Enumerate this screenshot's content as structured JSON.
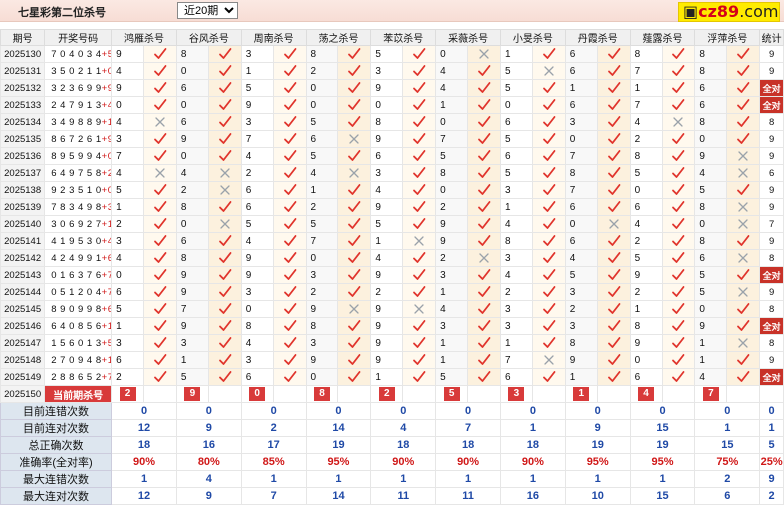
{
  "header": {
    "title": "七星彩第二位杀号",
    "range_selected": "近20期",
    "brand": {
      "icon": "square-icon",
      "main": "cz89",
      "domain": ".com"
    }
  },
  "columns": [
    "期号",
    "开奖号码",
    "鸿雁杀号",
    "谷风杀号",
    "周南杀号",
    "荡之杀号",
    "苯苡杀号",
    "采薇杀号",
    "小旻杀号",
    "丹霞杀号",
    "薤露杀号",
    "浮萍杀号",
    "统计"
  ],
  "rows": [
    {
      "p": "2025130",
      "d": "704034",
      "s": "+5",
      "k": [
        [
          "9",
          1
        ],
        [
          "8",
          1
        ],
        [
          "3",
          1
        ],
        [
          "8",
          1
        ],
        [
          "5",
          1
        ],
        [
          "0",
          0
        ],
        [
          "1",
          1
        ],
        [
          "6",
          1
        ],
        [
          "8",
          1
        ],
        [
          "8",
          1
        ]
      ],
      "st": "9"
    },
    {
      "p": "2025131",
      "d": "350211",
      "s": "+0",
      "k": [
        [
          "4",
          1
        ],
        [
          "0",
          1
        ],
        [
          "1",
          1
        ],
        [
          "2",
          1
        ],
        [
          "3",
          1
        ],
        [
          "4",
          1
        ],
        [
          "5",
          0
        ],
        [
          "6",
          1
        ],
        [
          "7",
          1
        ],
        [
          "8",
          1
        ]
      ],
      "st": "9"
    },
    {
      "p": "2025132",
      "d": "323699",
      "s": "+9",
      "k": [
        [
          "9",
          1
        ],
        [
          "6",
          1
        ],
        [
          "5",
          1
        ],
        [
          "0",
          1
        ],
        [
          "9",
          1
        ],
        [
          "4",
          1
        ],
        [
          "5",
          1
        ],
        [
          "1",
          1
        ],
        [
          "1",
          1
        ],
        [
          "6",
          1
        ]
      ],
      "st": "全对"
    },
    {
      "p": "2025133",
      "d": "247913",
      "s": "+4",
      "k": [
        [
          "0",
          1
        ],
        [
          "0",
          1
        ],
        [
          "9",
          1
        ],
        [
          "0",
          1
        ],
        [
          "0",
          1
        ],
        [
          "1",
          1
        ],
        [
          "0",
          1
        ],
        [
          "6",
          1
        ],
        [
          "7",
          1
        ],
        [
          "6",
          1
        ]
      ],
      "st": "全对"
    },
    {
      "p": "2025134",
      "d": "349889",
      "s": "+13",
      "k": [
        [
          "4",
          0
        ],
        [
          "6",
          1
        ],
        [
          "3",
          1
        ],
        [
          "5",
          1
        ],
        [
          "8",
          1
        ],
        [
          "0",
          1
        ],
        [
          "6",
          1
        ],
        [
          "3",
          1
        ],
        [
          "4",
          0
        ],
        [
          "8",
          1
        ]
      ],
      "st": "8"
    },
    {
      "p": "2025135",
      "d": "867261",
      "s": "+9",
      "k": [
        [
          "3",
          1
        ],
        [
          "9",
          1
        ],
        [
          "7",
          1
        ],
        [
          "6",
          0
        ],
        [
          "9",
          1
        ],
        [
          "7",
          1
        ],
        [
          "5",
          1
        ],
        [
          "0",
          1
        ],
        [
          "2",
          1
        ],
        [
          "0",
          1
        ]
      ],
      "st": "9"
    },
    {
      "p": "2025136",
      "d": "895994",
      "s": "+0",
      "k": [
        [
          "7",
          1
        ],
        [
          "0",
          1
        ],
        [
          "4",
          1
        ],
        [
          "5",
          1
        ],
        [
          "6",
          1
        ],
        [
          "5",
          1
        ],
        [
          "6",
          1
        ],
        [
          "7",
          1
        ],
        [
          "8",
          1
        ],
        [
          "9",
          0
        ]
      ],
      "st": "9"
    },
    {
      "p": "2025137",
      "d": "649758",
      "s": "+2",
      "k": [
        [
          "4",
          0
        ],
        [
          "4",
          0
        ],
        [
          "2",
          1
        ],
        [
          "4",
          0
        ],
        [
          "3",
          1
        ],
        [
          "8",
          1
        ],
        [
          "5",
          1
        ],
        [
          "8",
          1
        ],
        [
          "5",
          1
        ],
        [
          "4",
          0
        ]
      ],
      "st": "6"
    },
    {
      "p": "2025138",
      "d": "923510",
      "s": "+0",
      "k": [
        [
          "5",
          1
        ],
        [
          "2",
          0
        ],
        [
          "6",
          1
        ],
        [
          "1",
          1
        ],
        [
          "4",
          1
        ],
        [
          "0",
          1
        ],
        [
          "3",
          1
        ],
        [
          "7",
          1
        ],
        [
          "0",
          1
        ],
        [
          "5",
          1
        ]
      ],
      "st": "9"
    },
    {
      "p": "2025139",
      "d": "783498",
      "s": "+3",
      "k": [
        [
          "1",
          1
        ],
        [
          "8",
          1
        ],
        [
          "6",
          1
        ],
        [
          "2",
          1
        ],
        [
          "9",
          1
        ],
        [
          "2",
          1
        ],
        [
          "1",
          1
        ],
        [
          "6",
          1
        ],
        [
          "6",
          1
        ],
        [
          "8",
          0
        ]
      ],
      "st": "9"
    },
    {
      "p": "2025140",
      "d": "306927",
      "s": "+11",
      "k": [
        [
          "2",
          1
        ],
        [
          "0",
          0
        ],
        [
          "5",
          1
        ],
        [
          "5",
          1
        ],
        [
          "5",
          1
        ],
        [
          "9",
          1
        ],
        [
          "4",
          1
        ],
        [
          "0",
          0
        ],
        [
          "4",
          1
        ],
        [
          "0",
          0
        ]
      ],
      "st": "7"
    },
    {
      "p": "2025141",
      "d": "419530",
      "s": "+4",
      "k": [
        [
          "3",
          1
        ],
        [
          "6",
          1
        ],
        [
          "4",
          1
        ],
        [
          "7",
          1
        ],
        [
          "1",
          0
        ],
        [
          "9",
          1
        ],
        [
          "8",
          1
        ],
        [
          "6",
          1
        ],
        [
          "2",
          1
        ],
        [
          "8",
          1
        ]
      ],
      "st": "9"
    },
    {
      "p": "2025142",
      "d": "424991",
      "s": "+6",
      "k": [
        [
          "4",
          1
        ],
        [
          "8",
          1
        ],
        [
          "9",
          1
        ],
        [
          "0",
          1
        ],
        [
          "4",
          1
        ],
        [
          "2",
          0
        ],
        [
          "3",
          1
        ],
        [
          "4",
          1
        ],
        [
          "5",
          1
        ],
        [
          "6",
          0
        ]
      ],
      "st": "8"
    },
    {
      "p": "2025143",
      "d": "016376",
      "s": "+7",
      "k": [
        [
          "0",
          1
        ],
        [
          "9",
          1
        ],
        [
          "9",
          1
        ],
        [
          "3",
          1
        ],
        [
          "9",
          1
        ],
        [
          "3",
          1
        ],
        [
          "4",
          1
        ],
        [
          "5",
          1
        ],
        [
          "9",
          1
        ],
        [
          "5",
          1
        ]
      ],
      "st": "全对"
    },
    {
      "p": "2025144",
      "d": "051204",
      "s": "+7",
      "k": [
        [
          "6",
          1
        ],
        [
          "9",
          1
        ],
        [
          "3",
          1
        ],
        [
          "2",
          1
        ],
        [
          "2",
          1
        ],
        [
          "1",
          1
        ],
        [
          "2",
          1
        ],
        [
          "3",
          1
        ],
        [
          "2",
          1
        ],
        [
          "5",
          0
        ]
      ],
      "st": "9"
    },
    {
      "p": "2025145",
      "d": "890998",
      "s": "+6",
      "k": [
        [
          "5",
          1
        ],
        [
          "7",
          1
        ],
        [
          "0",
          1
        ],
        [
          "9",
          0
        ],
        [
          "9",
          0
        ],
        [
          "4",
          1
        ],
        [
          "3",
          1
        ],
        [
          "2",
          1
        ],
        [
          "1",
          1
        ],
        [
          "0",
          1
        ]
      ],
      "st": "8"
    },
    {
      "p": "2025146",
      "d": "640856",
      "s": "+13",
      "k": [
        [
          "1",
          1
        ],
        [
          "9",
          1
        ],
        [
          "8",
          1
        ],
        [
          "8",
          1
        ],
        [
          "9",
          1
        ],
        [
          "3",
          1
        ],
        [
          "3",
          1
        ],
        [
          "3",
          1
        ],
        [
          "8",
          1
        ],
        [
          "9",
          1
        ]
      ],
      "st": "全对"
    },
    {
      "p": "2025147",
      "d": "156013",
      "s": "+5",
      "k": [
        [
          "3",
          1
        ],
        [
          "3",
          1
        ],
        [
          "4",
          1
        ],
        [
          "3",
          1
        ],
        [
          "9",
          1
        ],
        [
          "1",
          1
        ],
        [
          "1",
          1
        ],
        [
          "8",
          1
        ],
        [
          "9",
          1
        ],
        [
          "1",
          0
        ]
      ],
      "st": "8"
    },
    {
      "p": "2025148",
      "d": "270948",
      "s": "+10",
      "k": [
        [
          "6",
          1
        ],
        [
          "1",
          1
        ],
        [
          "3",
          1
        ],
        [
          "9",
          1
        ],
        [
          "9",
          1
        ],
        [
          "1",
          1
        ],
        [
          "7",
          0
        ],
        [
          "9",
          1
        ],
        [
          "0",
          1
        ],
        [
          "1",
          1
        ]
      ],
      "st": "9"
    },
    {
      "p": "2025149",
      "d": "288652",
      "s": "+7",
      "k": [
        [
          "2",
          1
        ],
        [
          "5",
          1
        ],
        [
          "6",
          1
        ],
        [
          "0",
          1
        ],
        [
          "1",
          1
        ],
        [
          "5",
          1
        ],
        [
          "6",
          1
        ],
        [
          "1",
          1
        ],
        [
          "6",
          1
        ],
        [
          "4",
          1
        ]
      ],
      "st": "全对"
    }
  ],
  "current": {
    "p": "2025150",
    "label": "当前期杀号",
    "k": [
      "2",
      "9",
      "0",
      "8",
      "2",
      "5",
      "3",
      "1",
      "4",
      "7"
    ]
  },
  "stats": [
    {
      "label": "目前连错次数",
      "v": [
        "0",
        "0",
        "0",
        "0",
        "0",
        "0",
        "0",
        "0",
        "0",
        "0",
        "0"
      ],
      "red": false
    },
    {
      "label": "目前连对次数",
      "v": [
        "12",
        "9",
        "2",
        "14",
        "4",
        "7",
        "1",
        "9",
        "15",
        "1",
        "1"
      ],
      "red": false
    },
    {
      "label": "总正确次数",
      "v": [
        "18",
        "16",
        "17",
        "19",
        "18",
        "18",
        "18",
        "19",
        "19",
        "15",
        "5"
      ],
      "red": false
    },
    {
      "label": "准确率(全对率)",
      "v": [
        "90%",
        "80%",
        "85%",
        "95%",
        "90%",
        "90%",
        "90%",
        "95%",
        "95%",
        "75%",
        "25%"
      ],
      "red": true
    },
    {
      "label": "最大连错次数",
      "v": [
        "1",
        "4",
        "1",
        "1",
        "1",
        "1",
        "1",
        "1",
        "1",
        "2",
        "9"
      ],
      "red": false
    },
    {
      "label": "最大连对次数",
      "v": [
        "12",
        "9",
        "7",
        "14",
        "11",
        "11",
        "16",
        "10",
        "15",
        "6",
        "2"
      ],
      "red": false
    }
  ]
}
